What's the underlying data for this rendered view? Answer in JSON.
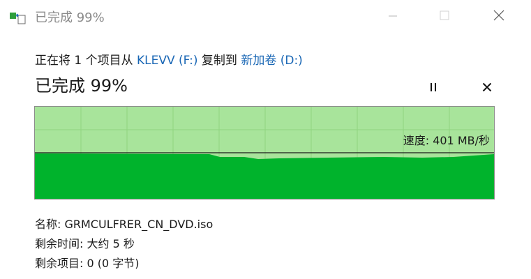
{
  "window": {
    "title": "已完成 99%",
    "app_icon": "copy-transfer-icon"
  },
  "copy": {
    "prefix": "正在将 1 个项目从 ",
    "source": "KLEVV (F:)",
    "middle": " 复制到 ",
    "destination": "新加卷 (D:)"
  },
  "progress": {
    "title": "已完成 99%",
    "percent": 99
  },
  "graph": {
    "speed_label": "速度: 401 MB/秒",
    "fill_color": "#00b32c",
    "background_color": "#a8e49b"
  },
  "details": {
    "name_label": "名称: ",
    "name_value": "GRMCULFRER_CN_DVD.iso",
    "time_label": "剩余时间: ",
    "time_value": "大约 5 秒",
    "items_label": "剩余项目: ",
    "items_value": "0 (0 字节)"
  },
  "controls": {
    "pause_icon": "pause-icon",
    "cancel_icon": "close-icon"
  },
  "colors": {
    "link": "#1a67b5",
    "title_gray": "#8a8a8a"
  }
}
